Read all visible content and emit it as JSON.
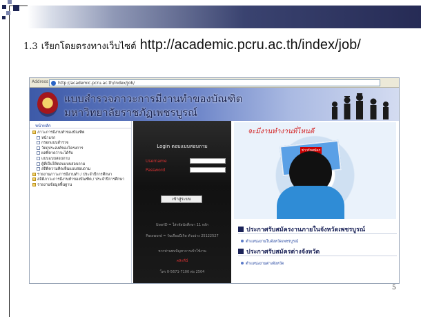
{
  "slide": {
    "number_prefix": "1.3",
    "instruction": "เรียกโดยตรงทางเว็บไซต์",
    "url": "http://academic.pcru.ac.th/index/job/",
    "page_number": "5"
  },
  "browser": {
    "address_label": "Address",
    "address_value": "http://academic.pcru.ac.th/index/job/"
  },
  "site": {
    "title_line1": "แบบสำรวจภาวะการมีงานทำของบัณฑิต",
    "title_line2": "มหาวิทยาลัยราชภัฏเพชรบูรณ์",
    "nav_tab": "หน้าหลัก",
    "nav_items": [
      {
        "label": "ภาวะการมีงานทำของบัณฑิต",
        "type": "folder"
      },
      {
        "label": "หน้าแรก",
        "type": "page"
      },
      {
        "label": "กรอกแบบสำรวจ",
        "type": "page"
      },
      {
        "label": "วัตถุประสงค์ของโครงการ",
        "type": "page"
      },
      {
        "label": "ผลที่คาดว่าจะได้รับ",
        "type": "page"
      },
      {
        "label": "แบบแบบสอบถาม",
        "type": "page"
      },
      {
        "label": "ผู้ที่เป็นให้ตอบแบบสอบถาม",
        "type": "page"
      },
      {
        "label": "สถิติความคิดเห็นแบบสอบถาม",
        "type": "page"
      },
      {
        "label": "รายงานภาวะการมีงานทำ / ประจำปีการศึกษา",
        "type": "folder"
      },
      {
        "label": "สถิติภาวะการมีงานทำของบัณฑิต / ประจำปีการศึกษา",
        "type": "folder"
      },
      {
        "label": "รายงานข้อมูลพื้นฐาน",
        "type": "folder"
      }
    ],
    "login": {
      "header": "Login ตอบแบบสอบถาม",
      "username_label": "Username",
      "password_label": "Password",
      "submit_label": "เข้าสู่ระบบ",
      "note1": "UserID = ใส่รหัสนักศึกษา 11 หลัก",
      "note2": "Password = วันเดือนปีเกิด ตัวอย่าง 25122527",
      "note3": "หากท่านพบปัญหาการเข้าใช้งาน",
      "note4": "คลิกที่นี่",
      "note5": "โทร 0-5671-7100 ต่อ 2504"
    },
    "poster_slogan": "จะมีงานทำงานที่ไหนดี",
    "poster_label": "ข่าวรับสมัคร",
    "section1_heading": "ประกาศรับสมัครงานภายในจังหวัดเพชรบูรณ์",
    "section1_link": "ตำแหน่งงานในจังหวัดเพชรบูรณ์",
    "section2_heading": "ประกาศรับสมัครต่างจังหวัด",
    "section2_link": "ตำแหน่งงานต่างจังหวัด"
  },
  "colors": {
    "topbar_dark": "#262b55",
    "banner_blue": "#3d5aa8",
    "login_bg": "#111111",
    "accent_red": "#d21a1a"
  }
}
